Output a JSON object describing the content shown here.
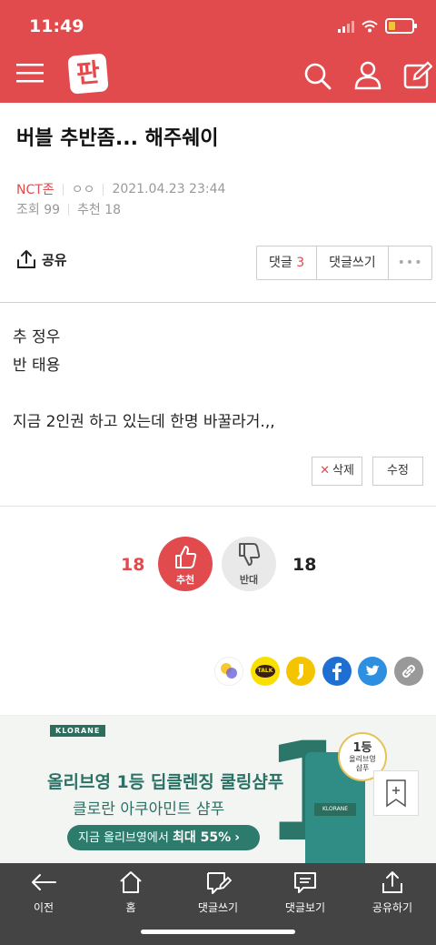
{
  "status": {
    "time": "11:49"
  },
  "header": {
    "logo": "판",
    "menu_icon": "hamburger-icon",
    "search_icon": "search-icon",
    "user_icon": "user-icon",
    "write_icon": "edit-icon",
    "color": "#e14b4d"
  },
  "post": {
    "title": "버블 추반좀... 해주쉐이",
    "category": "NCT존",
    "author": "ㅇㅇ",
    "datetime": "2021.04.23 23:44",
    "views": "조회 99",
    "recommends": "추천 18"
  },
  "actions": {
    "share_label": "공유",
    "comments_label": "댓글",
    "comments_count": "3",
    "write_comment_label": "댓글쓰기",
    "more_label": "•••"
  },
  "content": {
    "lines": [
      "추 정우",
      "반 태용",
      "",
      "지금 2인권 하고 있는데 한명 바꿀라거.,,"
    ]
  },
  "edit": {
    "delete_label": "삭제",
    "edit_label": "수정"
  },
  "votes": {
    "up_count": "18",
    "up_label": "추천",
    "down_label": "반대",
    "down_count": "18"
  },
  "social": [
    "kakaostory-icon",
    "kakaotalk-icon",
    "comment-quote-icon",
    "facebook-icon",
    "twitter-icon",
    "link-icon"
  ],
  "social_talk_label": "TALK",
  "ad": {
    "brand": "KLORANE",
    "big_number": "1",
    "line1": "올리브영 1등",
    "line1_tail": " 딥클렌징 쿨링샴푸",
    "line2": "클로란 아쿠아민트 샴푸",
    "cta_prefix": "지금 올리브영에서 ",
    "cta_bold": "최대 55%",
    "cta_arrow": "›",
    "badge_top": "1등",
    "badge_mid": "올리브영",
    "badge_bottom": "샴푸",
    "bottle_label": "KLORANE"
  },
  "bottom_nav": [
    {
      "label": "이전",
      "icon": "back-arrow-icon"
    },
    {
      "label": "홈",
      "icon": "home-icon"
    },
    {
      "label": "댓글쓰기",
      "icon": "write-comment-icon"
    },
    {
      "label": "댓글보기",
      "icon": "view-comments-icon"
    },
    {
      "label": "공유하기",
      "icon": "share-icon"
    }
  ]
}
